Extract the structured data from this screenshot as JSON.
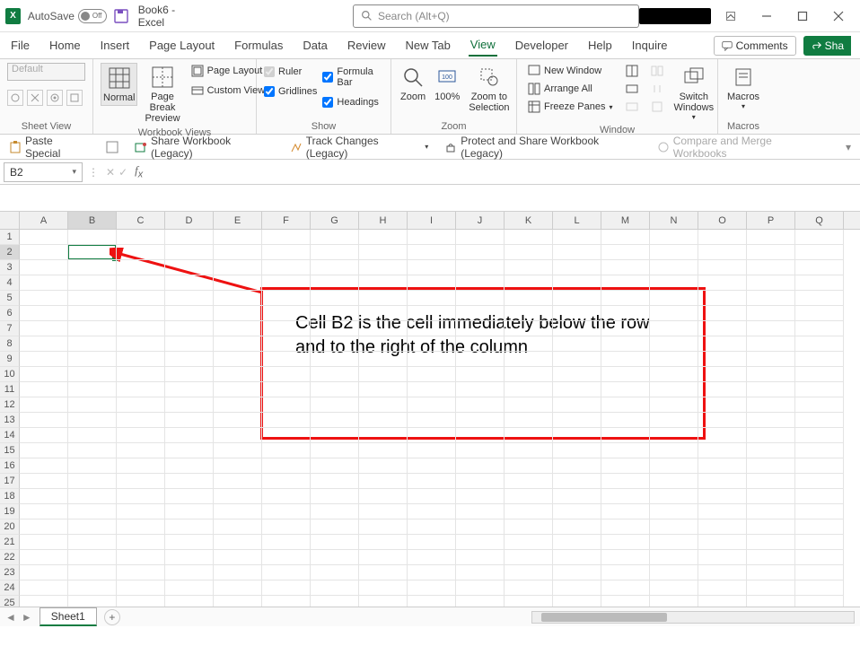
{
  "title": {
    "autosave_label": "AutoSave",
    "autosave_state": "Off",
    "workbook": "Book6  -  Excel",
    "search_placeholder": "Search (Alt+Q)"
  },
  "menu": {
    "items": [
      "File",
      "Home",
      "Insert",
      "Page Layout",
      "Formulas",
      "Data",
      "Review",
      "New Tab",
      "View",
      "Developer",
      "Help",
      "Inquire"
    ],
    "active": "View",
    "comments": "Comments",
    "share": "Sha"
  },
  "ribbon": {
    "sheet_view": {
      "label": "Sheet View",
      "default": "Default"
    },
    "workbook_views": {
      "label": "Workbook Views",
      "normal": "Normal",
      "page_break": "Page Break Preview",
      "page_layout": "Page Layout",
      "custom_views": "Custom Views"
    },
    "show": {
      "label": "Show",
      "ruler": "Ruler",
      "formula_bar": "Formula Bar",
      "gridlines": "Gridlines",
      "headings": "Headings"
    },
    "zoom": {
      "label": "Zoom",
      "zoom": "Zoom",
      "hundred": "100%",
      "to_selection": "Zoom to Selection"
    },
    "window": {
      "label": "Window",
      "new_window": "New Window",
      "arrange_all": "Arrange All",
      "freeze_panes": "Freeze Panes",
      "switch_windows": "Switch Windows"
    },
    "macros": {
      "label": "Macros",
      "macros": "Macros"
    }
  },
  "quickbar": {
    "paste_special": "Paste Special",
    "share_workbook": "Share Workbook (Legacy)",
    "track_changes": "Track Changes (Legacy)",
    "protect_share": "Protect and Share Workbook (Legacy)",
    "compare_merge": "Compare and Merge Workbooks"
  },
  "namebox": "B2",
  "sheet_tab": "Sheet1",
  "columns": [
    "A",
    "B",
    "C",
    "D",
    "E",
    "F",
    "G",
    "H",
    "I",
    "J",
    "K",
    "L",
    "M",
    "N",
    "O",
    "P",
    "Q"
  ],
  "rows": [
    "1",
    "2",
    "3",
    "4",
    "5",
    "6",
    "7",
    "8",
    "9",
    "10",
    "11",
    "12",
    "13",
    "14",
    "15",
    "16",
    "17",
    "18",
    "19",
    "20",
    "21",
    "22",
    "23",
    "24",
    "25"
  ],
  "annotation": "Cell B2 is the cell immediately below the row and to the right of the column"
}
